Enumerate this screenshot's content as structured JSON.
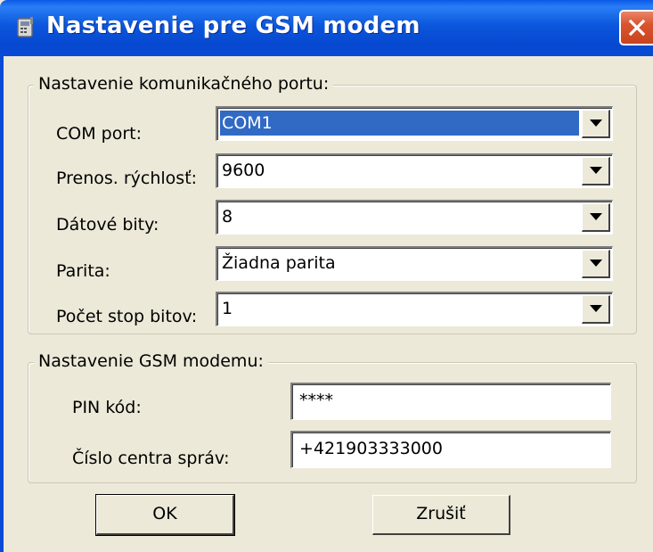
{
  "window": {
    "title": "Nastavenie pre GSM modem"
  },
  "port_group": {
    "legend": "Nastavenie komunikačného portu:",
    "fields": [
      {
        "label": "COM port:",
        "value": "COM1"
      },
      {
        "label": "Prenos. rýchlosť:",
        "value": "9600"
      },
      {
        "label": "Dátové bity:",
        "value": "8"
      },
      {
        "label": "Parita:",
        "value": "Žiadna parita"
      },
      {
        "label": "Počet stop bitov:",
        "value": "1"
      }
    ]
  },
  "gsm_group": {
    "legend": "Nastavenie GSM modemu:",
    "pin_label": "PIN kód:",
    "pin_value": "****",
    "smsc_label": "Číslo centra správ:",
    "smsc_value": "+421903333000"
  },
  "buttons": {
    "ok": "OK",
    "cancel": "Zrušiť"
  },
  "icons": {
    "title": "app-icon",
    "close": "close-icon",
    "dropdown": "chevron-down-icon"
  },
  "colors": {
    "titlebar": "#0b57dd",
    "close": "#d9542e",
    "selection": "#316ac5",
    "face": "#ece9d8"
  }
}
